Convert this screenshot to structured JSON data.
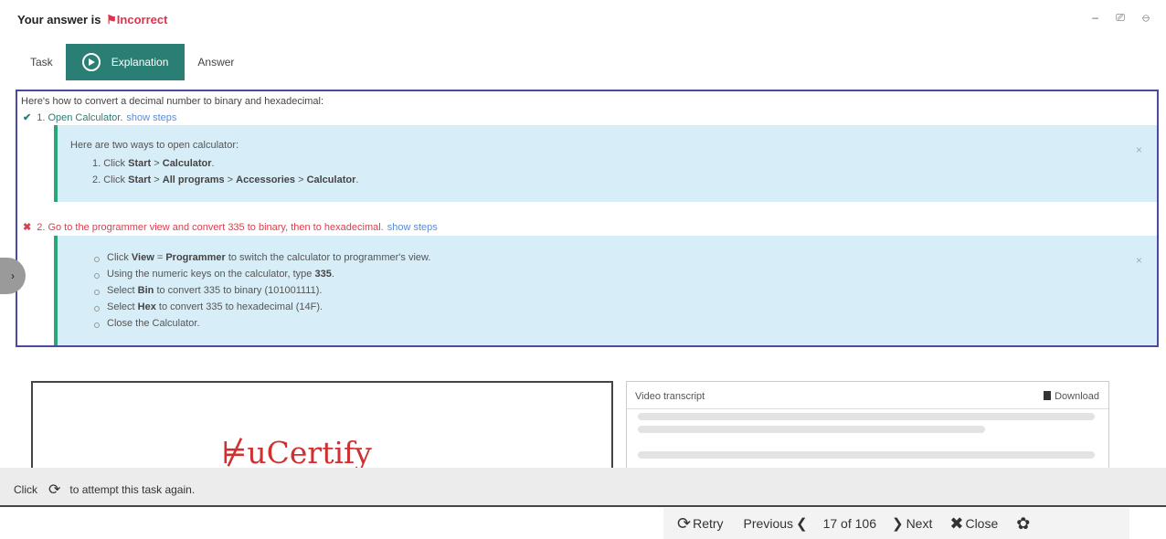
{
  "header": {
    "answer_prefix": "Your answer is",
    "answer_status": "Incorrect",
    "window_controls": "– ⎚ ⊖"
  },
  "tabs": [
    {
      "label": "Task"
    },
    {
      "label": "Explanation"
    },
    {
      "label": "Answer"
    }
  ],
  "explanation": {
    "intro": "Here's how to convert a decimal number to binary and hexadecimal:",
    "step1": {
      "title": "1. Open Calculator.",
      "link": "show steps",
      "panel_intro": "Here are two ways to open calculator:",
      "line1_prefix": "1. Click",
      "line1_b1": "Start",
      "line1_sep": ">",
      "line1_b2": "Calculator",
      "line2_prefix": "2. Click",
      "line2_b1": "Start",
      "line2_b2": "All programs",
      "line2_b3": "Accessories",
      "line2_b4": "Calculator"
    },
    "step2": {
      "title": "2. Go to the programmer view and convert 335 to binary, then to hexadecimal.",
      "link": "show steps",
      "b1_pre": "Click",
      "b1_view": "View",
      "b1_eq": "=",
      "b1_prog": "Programmer",
      "b1_post": "to switch the calculator to programmer's view.",
      "b2_pre": "Using the numeric keys on the calculator, type",
      "b2_val": "335",
      "b3_pre": "Select",
      "b3_bin": "Bin",
      "b3_post": "to convert 335 to binary (101001111).",
      "b4_pre": "Select",
      "b4_hex": "Hex",
      "b4_post": "to convert 335 to hexadecimal (14F).",
      "b5": "Close the Calculator."
    },
    "close_glyph": "×"
  },
  "video": {
    "brand": "uCertify",
    "brand_mark": "⊭"
  },
  "transcript": {
    "title": "Video transcript",
    "download_label": "Download"
  },
  "retry_bar": {
    "pre": "Click",
    "post": "to attempt this task again."
  },
  "navbar": {
    "retry": "Retry",
    "previous": "Previous",
    "counter": "17 of 106",
    "next": "Next",
    "close": "Close"
  },
  "colors": {
    "accent": "#2a7e73",
    "incorrect": "#e0334b",
    "panel_bg": "#d7edf7",
    "link": "#5b8bd8"
  }
}
